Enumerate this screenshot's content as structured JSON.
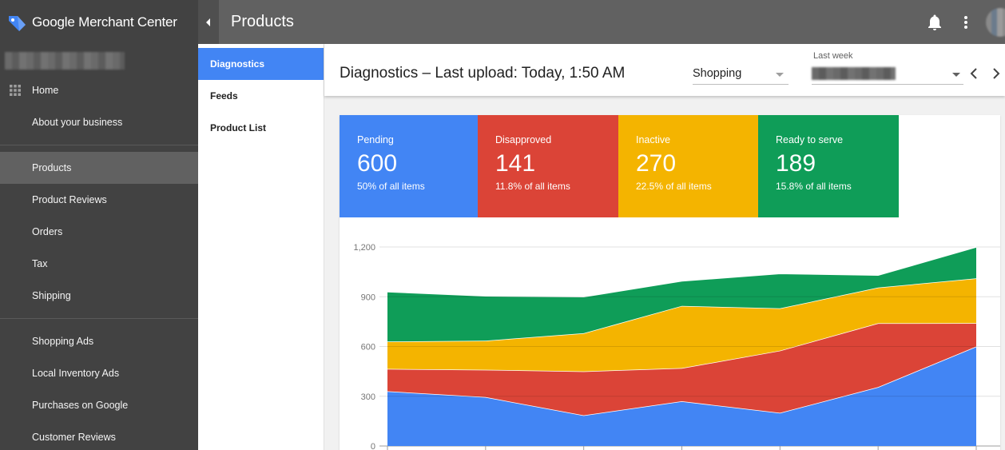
{
  "app": {
    "brand": "Google Merchant Center",
    "page_title": "Products"
  },
  "sidebar": {
    "home": "Home",
    "about": "About your business",
    "products": "Products",
    "product_reviews": "Product Reviews",
    "orders": "Orders",
    "tax": "Tax",
    "shipping": "Shipping",
    "shopping_ads": "Shopping Ads",
    "local_inventory_ads": "Local Inventory Ads",
    "purchases_on_google": "Purchases on Google",
    "customer_reviews": "Customer Reviews"
  },
  "subnav": {
    "diagnostics": "Diagnostics",
    "feeds": "Feeds",
    "product_list": "Product List"
  },
  "header": {
    "title": "Diagnostics – Last upload: Today, 1:50 AM",
    "channel_value": "Shopping",
    "date_label": "Last week"
  },
  "stats": [
    {
      "label": "Pending",
      "value": "600",
      "sub": "50% of all items",
      "color": "#4285f4"
    },
    {
      "label": "Disapproved",
      "value": "141",
      "sub": "11.8% of all items",
      "color": "#db4437"
    },
    {
      "label": "Inactive",
      "value": "270",
      "sub": "22.5% of all items",
      "color": "#f4b400"
    },
    {
      "label": "Ready to serve",
      "value": "189",
      "sub": "15.8% of all items",
      "color": "#0f9d58"
    }
  ],
  "chart_data": {
    "type": "area",
    "stacked": true,
    "ylim": [
      0,
      1200
    ],
    "yticks": [
      0,
      300,
      600,
      900,
      1200
    ],
    "ytick_labels": [
      "0",
      "300",
      "600",
      "900",
      "1,200"
    ],
    "grid": true,
    "x": [
      1,
      2,
      3,
      4,
      5,
      6,
      7
    ],
    "series": [
      {
        "name": "Pending",
        "color": "#4285f4",
        "values": [
          330,
          295,
          185,
          270,
          200,
          355,
          600
        ]
      },
      {
        "name": "Disapproved",
        "color": "#db4437",
        "values": [
          135,
          165,
          265,
          200,
          375,
          385,
          141
        ]
      },
      {
        "name": "Inactive",
        "color": "#f4b400",
        "values": [
          165,
          175,
          230,
          375,
          255,
          215,
          270
        ]
      },
      {
        "name": "Ready to serve",
        "color": "#0f9d58",
        "values": [
          300,
          270,
          220,
          150,
          210,
          75,
          189
        ]
      }
    ]
  }
}
